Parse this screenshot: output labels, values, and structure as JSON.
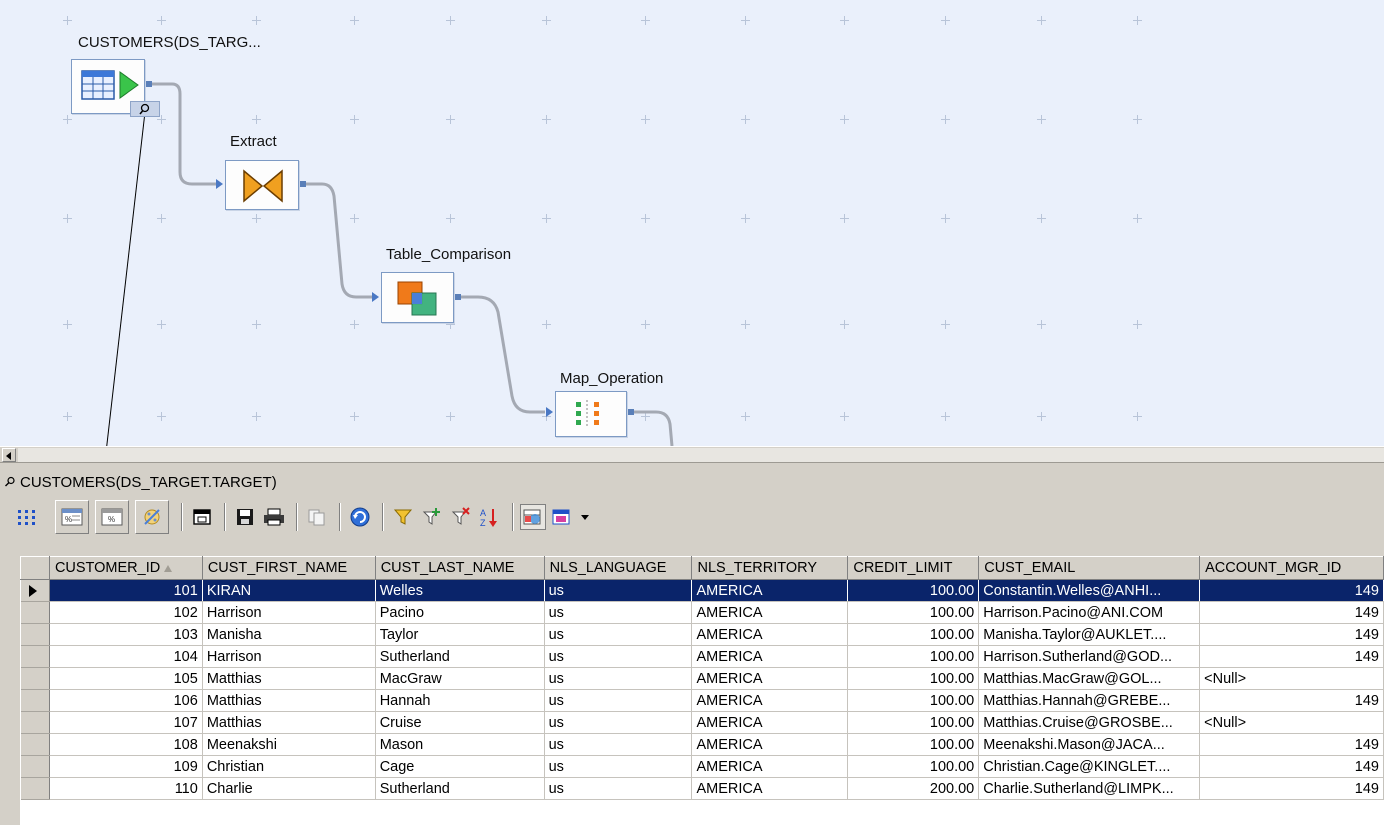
{
  "canvas": {
    "nodes": [
      {
        "id": "customers",
        "label": "CUSTOMERS(DS_TARG..."
      },
      {
        "id": "extract",
        "label": "Extract"
      },
      {
        "id": "table_comparison",
        "label": "Table_Comparison"
      },
      {
        "id": "map_operation",
        "label": "Map_Operation"
      }
    ]
  },
  "panel": {
    "title": "CUSTOMERS(DS_TARGET.TARGET)",
    "toolbar": [
      "grid-dots-icon",
      "view-data-tab-icon",
      "view-schema-tab-icon",
      "profile-tab-icon",
      "restore-icon",
      "save-icon",
      "print-icon",
      "copy-icon",
      "refresh-icon",
      "filter-icon",
      "add-filter-icon",
      "remove-filter-icon",
      "sort-icon",
      "show-columns-icon",
      "settings-icon",
      "dropdown-arrow-icon"
    ]
  },
  "grid": {
    "columns": [
      "CUSTOMER_ID",
      "CUST_FIRST_NAME",
      "CUST_LAST_NAME",
      "NLS_LANGUAGE",
      "NLS_TERRITORY",
      "CREDIT_LIMIT",
      "CUST_EMAIL",
      "ACCOUNT_MGR_ID"
    ],
    "rows": [
      [
        "101",
        "KIRAN",
        "Welles",
        "us",
        "AMERICA",
        "100.00",
        "Constantin.Welles@ANHI...",
        "149"
      ],
      [
        "102",
        "Harrison",
        "Pacino",
        "us",
        "AMERICA",
        "100.00",
        "Harrison.Pacino@ANI.COM",
        "149"
      ],
      [
        "103",
        "Manisha",
        "Taylor",
        "us",
        "AMERICA",
        "100.00",
        "Manisha.Taylor@AUKLET....",
        "149"
      ],
      [
        "104",
        "Harrison",
        "Sutherland",
        "us",
        "AMERICA",
        "100.00",
        "Harrison.Sutherland@GOD...",
        "149"
      ],
      [
        "105",
        "Matthias",
        "MacGraw",
        "us",
        "AMERICA",
        "100.00",
        "Matthias.MacGraw@GOL...",
        "<Null>"
      ],
      [
        "106",
        "Matthias",
        "Hannah",
        "us",
        "AMERICA",
        "100.00",
        "Matthias.Hannah@GREBE...",
        "149"
      ],
      [
        "107",
        "Matthias",
        "Cruise",
        "us",
        "AMERICA",
        "100.00",
        "Matthias.Cruise@GROSBE...",
        "<Null>"
      ],
      [
        "108",
        "Meenakshi",
        "Mason",
        "us",
        "AMERICA",
        "100.00",
        "Meenakshi.Mason@JACA...",
        "149"
      ],
      [
        "109",
        "Christian",
        "Cage",
        "us",
        "AMERICA",
        "100.00",
        "Christian.Cage@KINGLET....",
        "149"
      ],
      [
        "110",
        "Charlie",
        "Sutherland",
        "us",
        "AMERICA",
        "200.00",
        "Charlie.Sutherland@LIMPK...",
        "149"
      ]
    ],
    "selected_row": 0,
    "sort_column": "CUSTOMER_ID"
  },
  "colors": {
    "canvas_bg": "#eaf0fb",
    "selection": "#0a246a",
    "chrome": "#d4d0c8"
  }
}
